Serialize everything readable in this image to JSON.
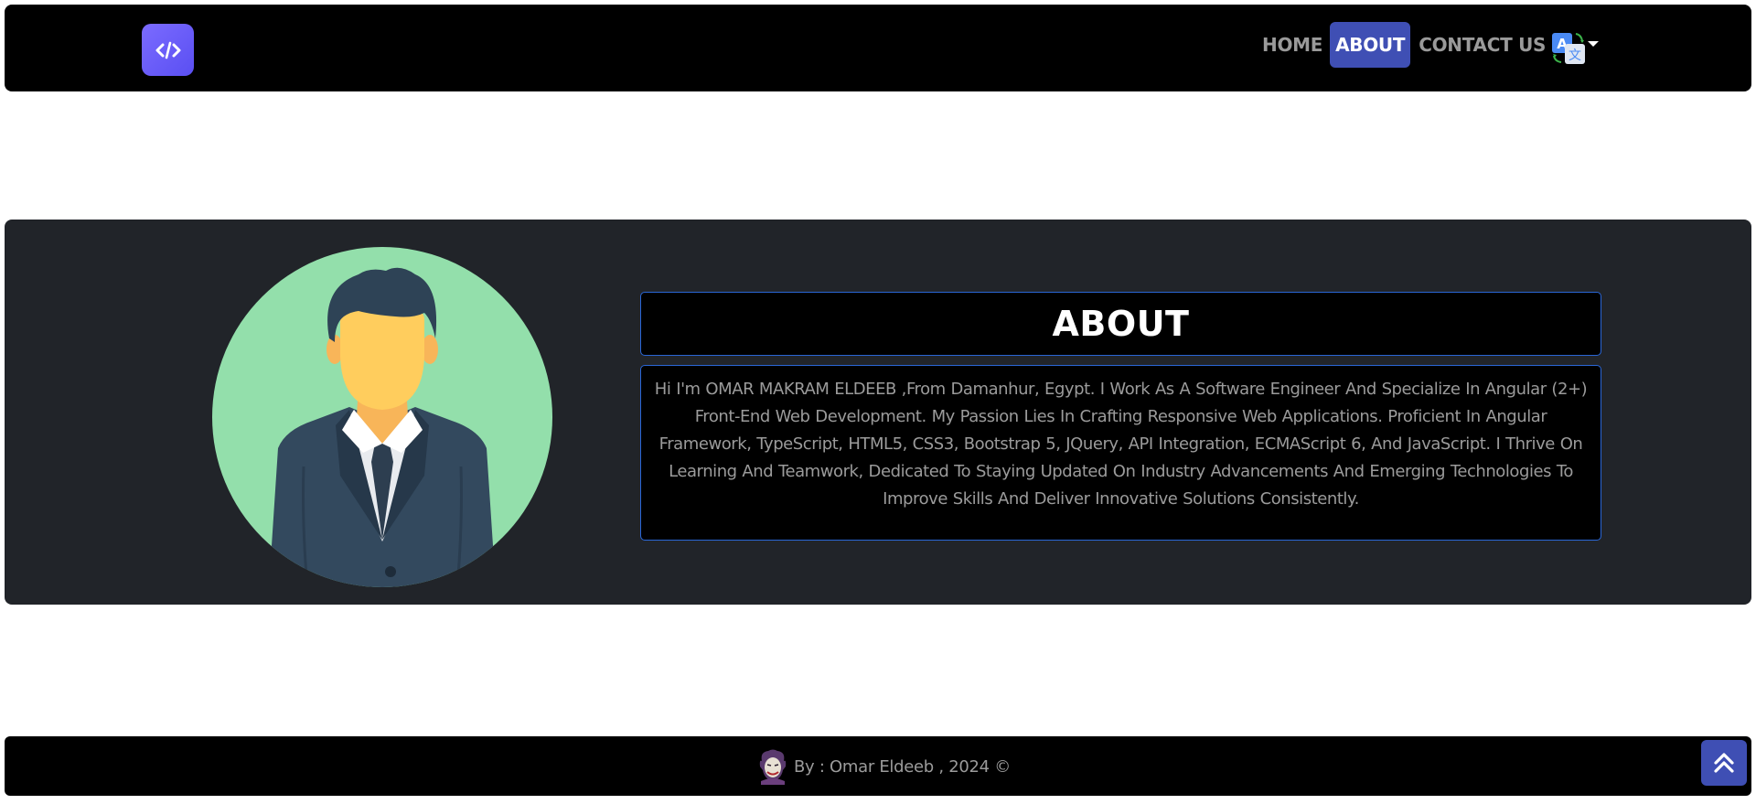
{
  "navbar": {
    "logo_icon": "code-icon",
    "links": [
      {
        "label": "HOME",
        "active": false
      },
      {
        "label": "ABOUT",
        "active": true
      },
      {
        "label": "CONTACT US",
        "active": false
      }
    ],
    "language_icon": "translate-icon",
    "accent_color": "#3f4fb4"
  },
  "about": {
    "title": "ABOUT",
    "avatar_icon": "businessman-avatar",
    "description": "Hi I'm OMAR MAKRAM ELDEEB ,From Damanhur, Egypt. I Work As A Software Engineer And Specialize In Angular (2+) Front-End Web Development. My Passion Lies In Crafting Responsive Web Applications. Proficient In Angular Framework, TypeScript, HTML5, CSS3, Bootstrap 5, JQuery, API Integration, ECMAScript 6, And JavaScript. I Thrive On Learning And Teamwork, Dedicated To Staying Updated On Industry Advancements And Emerging Technologies To Improve Skills And Deliver Innovative Solutions Consistently.",
    "border_color": "#2a66d6"
  },
  "footer": {
    "text": "By : Omar Eldeeb , 2024 ©",
    "avatar_icon": "joker-avatar",
    "scroll_top_icon": "double-chevron-up-icon"
  }
}
